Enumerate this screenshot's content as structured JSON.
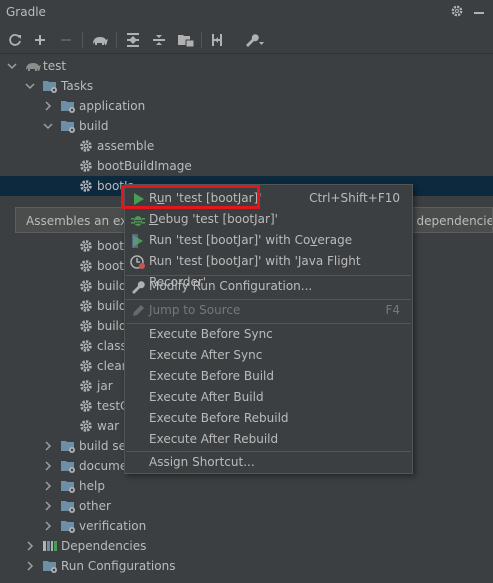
{
  "panel": {
    "title": "Gradle"
  },
  "toolbar": {
    "buttons": [
      "refresh",
      "add",
      "remove",
      "toggle-offline",
      "expand-all",
      "collapse-all",
      "group-modules",
      "toggle-skip-tests",
      "build-tool-settings"
    ]
  },
  "tree": {
    "root": "test",
    "tasks": "Tasks",
    "application": "application",
    "build": "build",
    "build_tasks": [
      "assemble",
      "bootBuildImage",
      "bootJar",
      "bootJarMainClassName",
      "bootRun",
      "bootRunMainClassName",
      "build",
      "buildDependents",
      "buildNeeded",
      "classes",
      "clean",
      "jar",
      "testClasses",
      "war"
    ],
    "visible_build_tasks": [
      "assemble",
      "bootBuildImage",
      "bootJar",
      "",
      "bootl",
      "bootl",
      "build",
      "build",
      "build",
      "classe",
      "clean",
      "jar",
      "testC",
      "war"
    ],
    "groups": [
      "build setup",
      "documentation",
      "help",
      "other",
      "verification"
    ],
    "visible_groups": [
      "build set",
      "docume",
      "help",
      "other",
      "verification"
    ],
    "dependencies": "Dependencies",
    "run_configurations": "Run Configurations",
    "selected_visible": "bootJa"
  },
  "tooltip": {
    "text": "Assembles an exec",
    "tail": "eir dependencie"
  },
  "context_menu": {
    "items": [
      {
        "label": "Run 'test [bootJar]'",
        "mnemonic": "u",
        "pre": "R",
        "post": "n 'test [bootJar]'",
        "shortcut": "Ctrl+Shift+F10",
        "icon": "run-icon"
      },
      {
        "label": "Debug 'test [bootJar]'",
        "mnemonic": "D",
        "pre": "",
        "post": "ebug 'test [bootJar]'",
        "shortcut": "",
        "icon": "debug-icon"
      },
      {
        "label": "Run 'test [bootJar]' with Coverage",
        "pre": "Run 'test [bootJar]' with Co",
        "mnemonic": "v",
        "post": "erage",
        "shortcut": "",
        "icon": "coverage-icon"
      },
      {
        "label": "Run 'test [bootJar]' with 'Java Flight Recorder'",
        "pre": "Run 'test [bootJar]' with 'Java Flight Recorder'",
        "mnemonic": "",
        "post": "",
        "shortcut": "",
        "icon": "profiler-icon"
      },
      {
        "label": "Modify Run Configuration...",
        "pre": "Modify Run Configuration...",
        "mnemonic": "",
        "post": "",
        "shortcut": "",
        "icon": "wrench-icon"
      },
      {
        "label": "Jump to Source",
        "pre": "Jump to Source",
        "mnemonic": "",
        "post": "",
        "shortcut": "F4",
        "icon": "pencil-icon",
        "disabled": true
      },
      {
        "label": "Execute Before Sync"
      },
      {
        "label": "Execute After Sync"
      },
      {
        "label": "Execute Before Build"
      },
      {
        "label": "Execute After Build"
      },
      {
        "label": "Execute Before Rebuild"
      },
      {
        "label": "Execute After Rebuild"
      },
      {
        "label": "Assign Shortcut..."
      }
    ]
  },
  "colors": {
    "background": "#3c3f41",
    "selection": "#0d293e",
    "run_green": "#499c54",
    "highlight_red": "#e0181d",
    "folder_blue": "#6e8ea5"
  }
}
